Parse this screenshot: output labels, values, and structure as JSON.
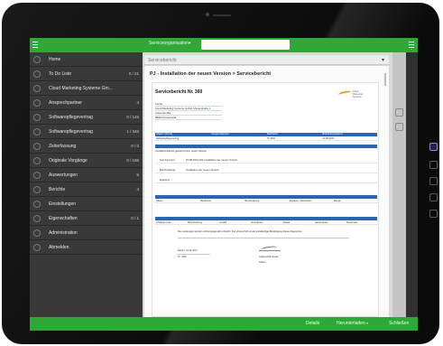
{
  "topbar": {
    "nav_label": "Serviceorganisation",
    "search_placeholder": ""
  },
  "sidebar": {
    "items": [
      {
        "label": "Home",
        "count": ""
      },
      {
        "label": "To Do Liste",
        "count": "0 / 21"
      },
      {
        "label": "Cloud Marketing Systeme Gm...",
        "count": ""
      },
      {
        "label": "Ansprechpartner",
        "count": "4"
      },
      {
        "label": "Softwarepflegevertrag",
        "count": "0 / 145"
      },
      {
        "label": "Softwarepflegevertrag",
        "count": "1 / 346"
      },
      {
        "label": "Zeiterfassung",
        "count": "0 / 0"
      },
      {
        "label": "Originale Vorgänge",
        "count": "0 / 186"
      },
      {
        "label": "Auswertungen",
        "count": "5"
      },
      {
        "label": "Berichte",
        "count": "4"
      },
      {
        "label": "Einstellungen",
        "count": ""
      },
      {
        "label": "Eigenschaften",
        "count": "0 / 1"
      },
      {
        "label": "Administration",
        "count": ""
      },
      {
        "label": "Abmelden",
        "count": ""
      }
    ]
  },
  "content": {
    "header_label": "Servicebericht",
    "breadcrumb": "PJ - Installation der neuen Version > Servicebericht"
  },
  "document": {
    "title": "Servicebericht Nr. 360",
    "logo_text": "Cloud Marketing Systeme",
    "address": [
      "Kunde",
      "Cloud Marketing Systeme GmbH, Musterstraße 1",
      "Antworten Bis",
      "88000 Musterstadt"
    ],
    "table1": {
      "headers": [
        "Objekt / Vertrag",
        "Ansprechpartner",
        "Bearbeiter",
        "Bearbeitungsdatum"
      ],
      "row": [
        "Softwarepflegevertrag",
        "",
        "Th.Wild",
        "21.08.2017"
      ]
    },
    "section_service": "Tätigkeiten",
    "service_line": "Installationsdienst gestartet beim neuen Version",
    "kv": [
      {
        "k": "Servicegrund",
        "v": "15.08.2014 001 Installation der neuen Version"
      },
      {
        "k": "Beschreibung",
        "v": "Installation der neuen Version"
      },
      {
        "k": "Ergebnis",
        "v": ""
      }
    ],
    "table2": {
      "title": "Arbeitsgrundlagen Arbeitszeit",
      "headers": [
        "Datum",
        "Bearbeiter",
        "Beschreibung",
        "Zeitraum / Arbeitszeit",
        "Menge"
      ]
    },
    "table3": {
      "title": "Ersatzteile / Material",
      "headers": [
        "Artikelnummer",
        "Beschreibung",
        "Anzahl",
        "Einzelpreis",
        "Rabatt",
        "Gesamtpreis",
        "Steuersatz"
      ]
    },
    "footnote": "Die Leistungen wurden ordnungsgemäß erbracht. Die Unterschrift ist als vollständige Bestätigung dieses Rapportes.",
    "sig_left_date": "Datum: 21.11.2017",
    "sig_left_name": "Th. Wild",
    "sig_right_label": "Unterschrift Kunde",
    "sig_right_sub": "Datum"
  },
  "bottombar": {
    "btn1": "Details",
    "btn2": "Herunterladen",
    "btn3": "Schließen"
  },
  "colors": {
    "accent_green": "#2ea836",
    "doc_blue": "#2b63b6",
    "sidebar_bg": "#393939"
  }
}
